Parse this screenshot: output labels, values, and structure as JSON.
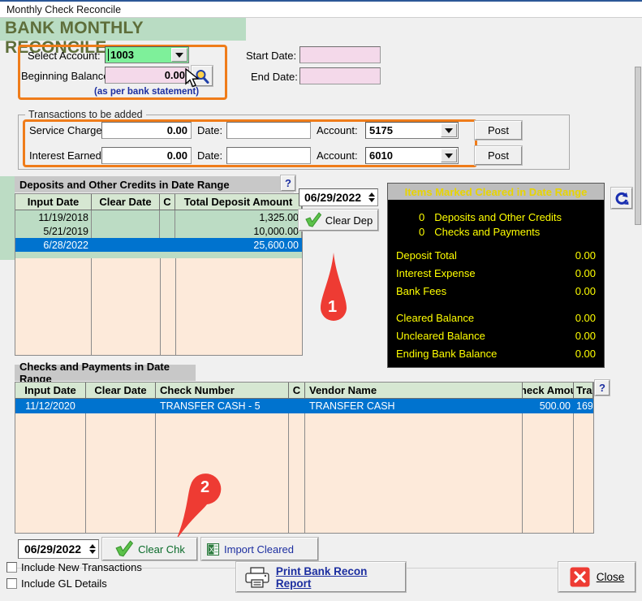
{
  "window": {
    "title": "Monthly Check Reconcile"
  },
  "banner": {
    "heading": "BANK MONTHLY RECONCILE"
  },
  "account_section": {
    "select_account_label": "Select Account:",
    "select_account_value": "1003",
    "beginning_balance_label": "Beginning Balance:",
    "beginning_balance_value": "0.00",
    "note": "(as per bank statement)",
    "start_date_label": "Start Date:",
    "start_date_value": "",
    "end_date_label": "End Date:",
    "end_date_value": "",
    "search_icon": "magnifier-icon"
  },
  "transactions": {
    "group_label": "Transactions to be added",
    "rows": [
      {
        "label": "Service Charge:",
        "amount": "0.00",
        "date_label": "Date:",
        "date_value": "",
        "account_label": "Account:",
        "account_value": "5175",
        "post_label": "Post"
      },
      {
        "label": "Interest Earned:",
        "amount": "0.00",
        "date_label": "Date:",
        "date_value": "",
        "account_label": "Account:",
        "account_value": "6010",
        "post_label": "Post"
      }
    ]
  },
  "deposits_grid": {
    "title": "Deposits and Other Credits in Date Range",
    "help_label": "?",
    "columns": [
      "Input Date",
      "Clear Date",
      "C",
      "Total Deposit Amount"
    ],
    "rows": [
      {
        "input_date": "11/19/2018",
        "clear_date": "",
        "c": "",
        "amount": "1,325.00",
        "selected": false
      },
      {
        "input_date": "5/21/2019",
        "clear_date": "",
        "c": "",
        "amount": "10,000.00",
        "selected": false
      },
      {
        "input_date": "6/28/2022",
        "clear_date": "",
        "c": "",
        "amount": "25,600.00",
        "selected": true
      }
    ],
    "date_value": "06/29/2022",
    "clear_button_label": "Clear Dep",
    "check_icon": "green-check-icon"
  },
  "cleared_panel": {
    "title": "Items Marked Cleared in Date Range",
    "counts": [
      {
        "count": "0",
        "label": "Deposits and Other Credits"
      },
      {
        "count": "0",
        "label": "Checks and Payments"
      }
    ],
    "totals": [
      {
        "label": "Deposit Total",
        "value": "0.00"
      },
      {
        "label": "Interest Expense",
        "value": "0.00"
      },
      {
        "label": "Bank Fees",
        "value": "0.00"
      }
    ],
    "balances": [
      {
        "label": "Cleared Balance",
        "value": "0.00"
      },
      {
        "label": "Uncleared Balance",
        "value": "0.00"
      },
      {
        "label": "Ending Bank Balance",
        "value": "0.00"
      }
    ],
    "refresh_icon": "refresh-icon"
  },
  "checks_grid": {
    "title": "Checks and Payments in Date Range",
    "help_label": "?",
    "columns": [
      "Input Date",
      "Clear Date",
      "Check Number",
      "C",
      "Vendor Name",
      "Check Amoun",
      "Tra"
    ],
    "rows": [
      {
        "input_date": "11/12/2020",
        "clear_date": "",
        "check_number": "TRANSFER CASH - 5",
        "c": "",
        "vendor_name": "TRANSFER CASH",
        "check_amount": "500.00",
        "tra": "169",
        "selected": true
      }
    ],
    "date_value": "06/29/2022",
    "clear_button_label": "Clear Chk",
    "check_icon": "green-check-icon",
    "import_button_label": "Import Cleared",
    "import_icon": "excel-icon"
  },
  "footer": {
    "checkboxes": [
      {
        "label": "Include New Transactions",
        "checked": false
      },
      {
        "label": "Include GL Details",
        "checked": false
      }
    ],
    "print_button_label": "Print Bank Recon Report",
    "print_icon": "printer-icon",
    "close_button_label": "Close",
    "close_icon": "red-x-icon"
  },
  "markers": [
    {
      "number": "1"
    },
    {
      "number": "2"
    }
  ],
  "colors": {
    "banner_bg": "#b9dcc3",
    "banner_text": "#5e6e3a",
    "highlight_outline": "#ef7c1a",
    "grid_body": "#fdeada",
    "grid_green": "#bcdcc4",
    "selection": "#0073cf",
    "panel_bg": "#000000",
    "panel_text": "#ffff00",
    "marker": "#ee3b33"
  }
}
